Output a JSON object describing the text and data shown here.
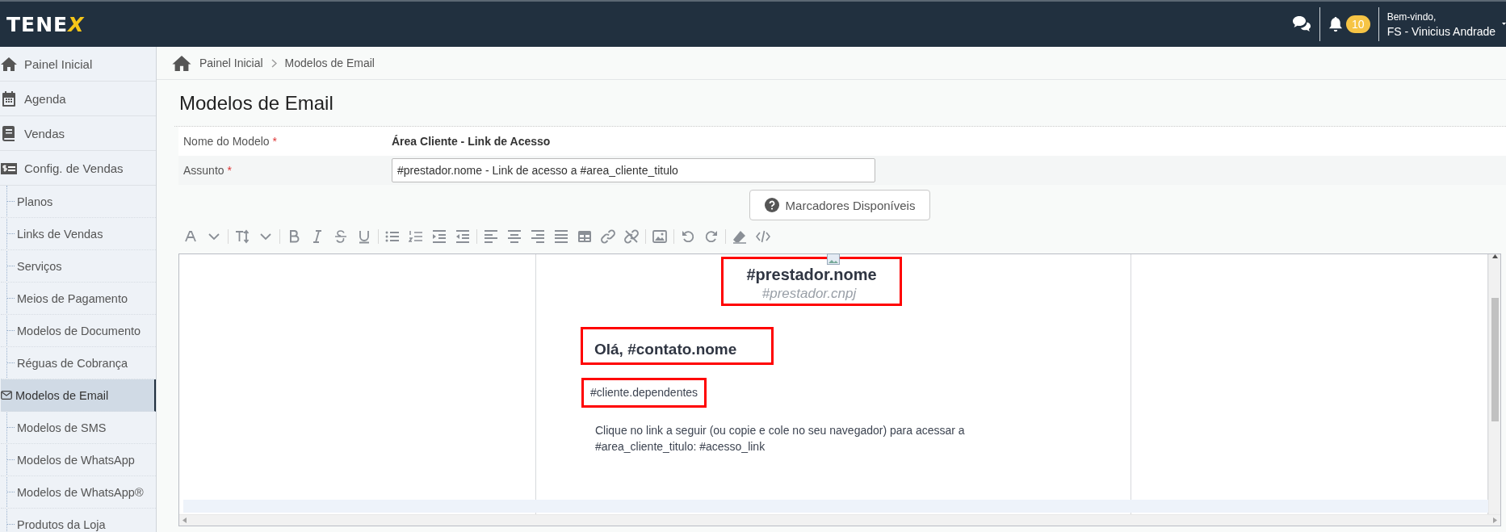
{
  "topbar": {
    "logo": "TENEX",
    "notification_count": "10",
    "greeting": "Bem-vindo,",
    "user_name": "FS - Vinicius Andrade"
  },
  "sidebar": {
    "items": [
      {
        "label": "Painel Inicial",
        "selected": false
      },
      {
        "label": "Agenda",
        "selected": false
      },
      {
        "label": "Vendas",
        "selected": false
      },
      {
        "label": "Config. de Vendas",
        "selected": false,
        "children": [
          {
            "label": "Planos",
            "selected": false
          },
          {
            "label": "Links de Vendas",
            "selected": false
          },
          {
            "label": "Serviços",
            "selected": false
          },
          {
            "label": "Meios de Pagamento",
            "selected": false
          },
          {
            "label": "Modelos de Documento",
            "selected": false
          },
          {
            "label": "Réguas de Cobrança",
            "selected": false
          },
          {
            "label": "Modelos de Email",
            "selected": true
          },
          {
            "label": "Modelos de SMS",
            "selected": false
          },
          {
            "label": "Modelos de WhatsApp",
            "selected": false
          },
          {
            "label": "Modelos de WhatsApp®",
            "selected": false
          },
          {
            "label": "Produtos da Loja",
            "selected": false
          }
        ]
      }
    ]
  },
  "breadcrumb": [
    "Painel Inicial",
    "Modelos de Email"
  ],
  "page_title": "Modelos de Email",
  "form": {
    "fields": [
      {
        "kind": "text",
        "label": "Nome do Modelo",
        "required_mark": "*",
        "value": "Área Cliente - Link de Acesso"
      },
      {
        "kind": "input",
        "label": "Assunto",
        "required_mark": "*",
        "value": "#prestador.nome - Link de acesso a #area_cliente_titulo"
      }
    ]
  },
  "markers_button": "Marcadores Disponíveis",
  "editor": {
    "blocks": [
      {
        "kind": "header",
        "title": "#prestador.nome",
        "subtitle": "#prestador.cnpj",
        "highlighted": true
      },
      {
        "kind": "greeting",
        "text": "Olá, #contato.nome",
        "highlighted": true
      },
      {
        "kind": "paragraph",
        "text": "#cliente.dependentes",
        "highlighted": true
      },
      {
        "kind": "paragraph",
        "text": "Clique no link a seguir (ou copie e cole no seu navegador) para acessar a #area_cliente_titulo: #acesso_link",
        "highlighted": false
      }
    ]
  }
}
